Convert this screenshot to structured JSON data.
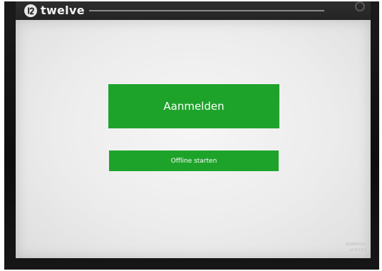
{
  "app": {
    "logo_text": "twelve",
    "logo_icon": "twelve-logo-icon",
    "brand_green": "#1ea32a"
  },
  "login": {
    "button_label": "Aanmelden"
  },
  "offline": {
    "button_label": "Offline starten"
  },
  "footer": {
    "device_id": "820955111",
    "version": "v7.6.12.1"
  }
}
